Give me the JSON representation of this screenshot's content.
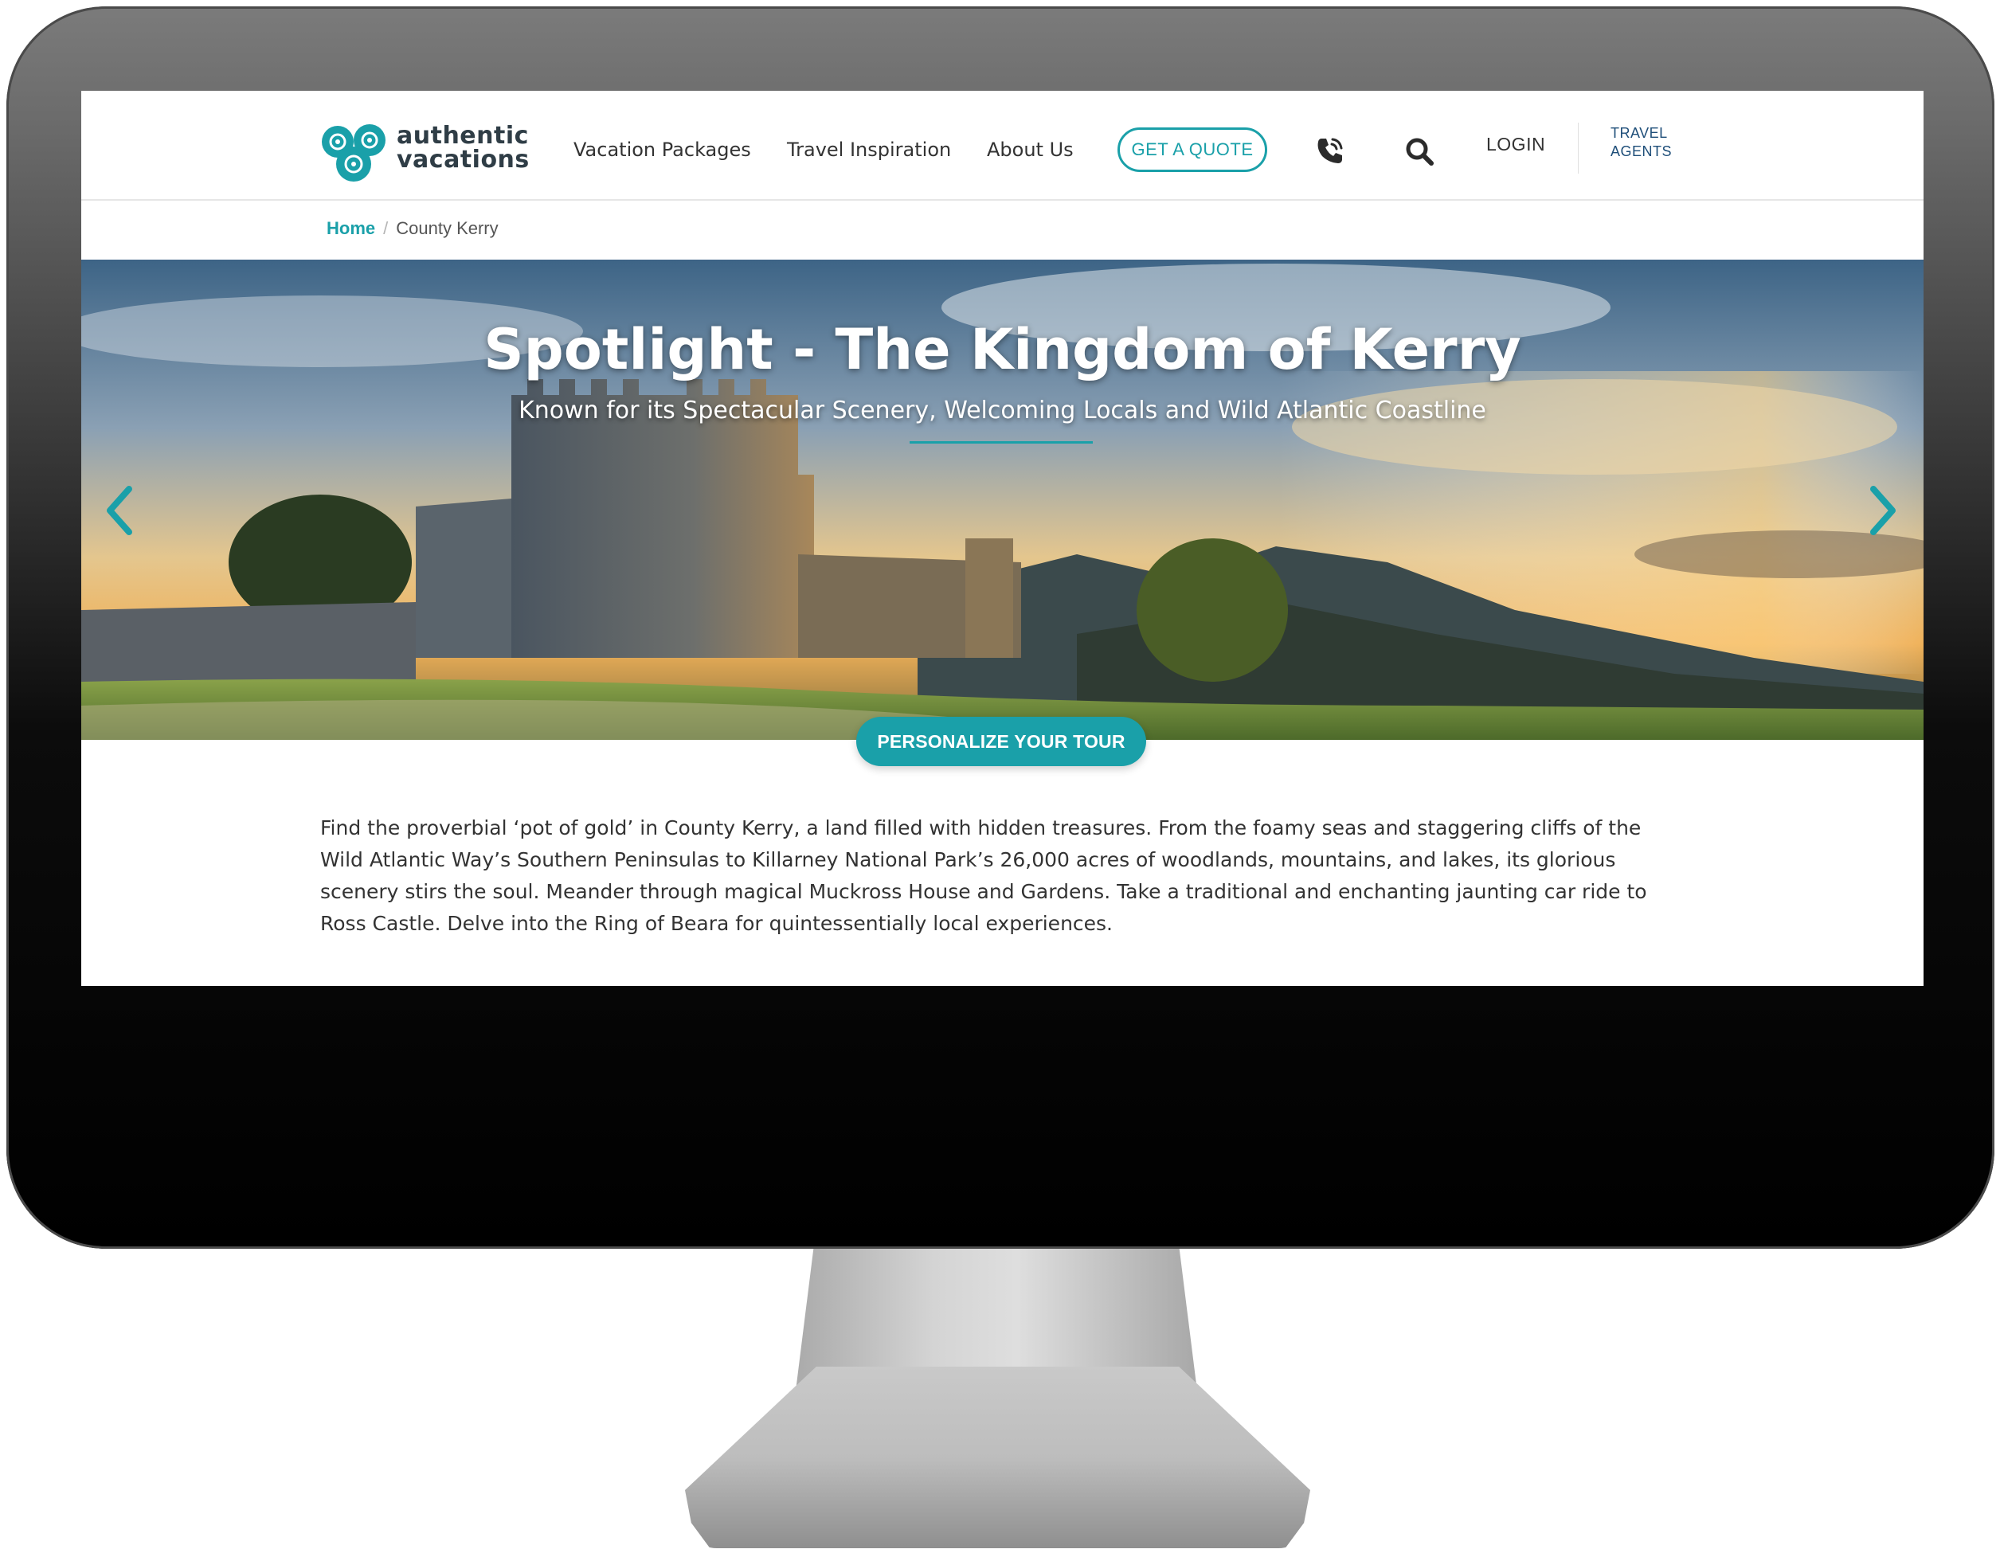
{
  "brand": {
    "name_line1": "authentic",
    "name_line2": "vacations",
    "accent": "#1aa0a9",
    "text_dark": "#2f3d46"
  },
  "nav": {
    "items": [
      {
        "label": "Vacation Packages"
      },
      {
        "label": "Travel Inspiration"
      },
      {
        "label": "About Us"
      }
    ],
    "quote_button": "GET A QUOTE",
    "phone_icon": "phone-icon",
    "search_icon": "search-icon",
    "login": "LOGIN",
    "travel_agents_line1": "TRAVEL",
    "travel_agents_line2": "AGENTS"
  },
  "breadcrumb": {
    "home": "Home",
    "separator": "/",
    "current": "County Kerry"
  },
  "hero": {
    "title": "Spotlight - The Kingdom of Kerry",
    "subtitle": "Known for its Spectacular Scenery, Welcoming Locals and Wild Atlantic Coastline",
    "prev_icon": "chevron-left-icon",
    "next_icon": "chevron-right-icon",
    "cta": "PERSONALIZE YOUR TOUR"
  },
  "content": {
    "intro": "Find the proverbial ‘pot of gold’ in County Kerry, a land filled with hidden treasures. From the foamy seas and staggering cliffs of the Wild Atlantic Way’s Southern Peninsulas to Killarney National Park’s 26,000 acres of woodlands, mountains, and lakes, its glorious scenery stirs the soul. Meander through magical Muckross House and Gardens. Take a traditional and enchanting jaunting car ride to Ross Castle. Delve into the Ring of Beara for quintessentially local experiences."
  }
}
